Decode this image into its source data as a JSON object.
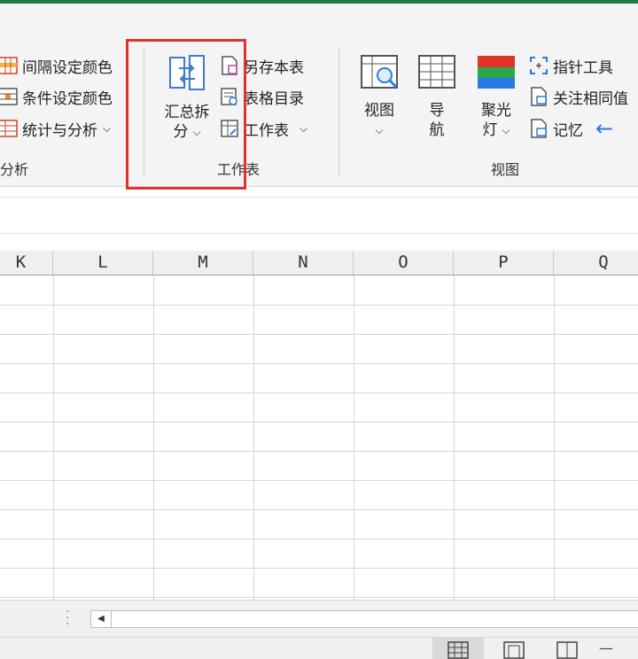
{
  "ribbon": {
    "left_items": [
      "间隔设定颜色",
      "条件设定颜色",
      "统计与分析"
    ],
    "left_group_label": "分析",
    "summary_split": {
      "line1": "汇总拆",
      "line2": "分"
    },
    "worksheet_items": [
      "另存本表",
      "表格目录",
      "工作表"
    ],
    "worksheet_group_label": "工作表",
    "view_buttons": [
      {
        "line1": "视图",
        "line2": ""
      },
      {
        "line1": "导",
        "line2": "航"
      },
      {
        "line1": "聚光",
        "line2": "灯"
      }
    ],
    "right_items": [
      "指针工具",
      "关注相同值",
      "记忆"
    ],
    "view_group_label": "视图",
    "arrow_glyph": "←"
  },
  "columns": [
    "K",
    "L",
    "M",
    "N",
    "O",
    "P",
    "Q"
  ],
  "colors": {
    "accent_green": "#1e7a45",
    "highlight_red": "#e0322d",
    "arrow_blue": "#2a7ae2"
  }
}
